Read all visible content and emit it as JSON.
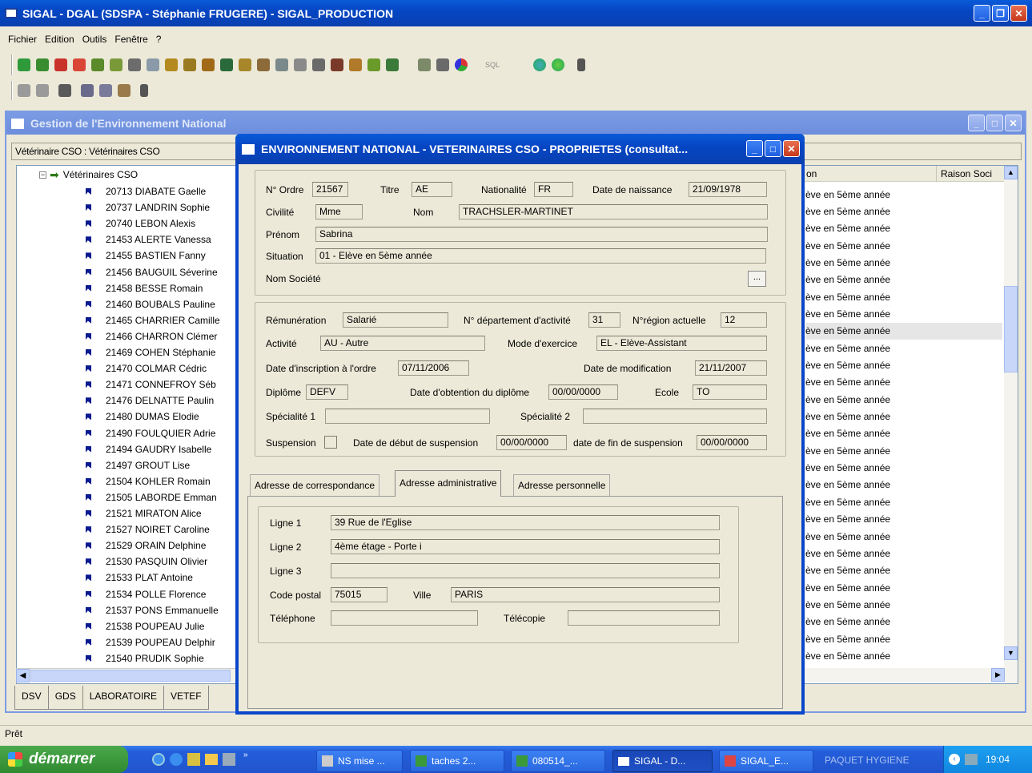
{
  "app": {
    "title": "SIGAL - DGAL (SDSPA - Stéphanie FRUGERE) - SIGAL_PRODUCTION",
    "menu": [
      "Fichier",
      "Edition",
      "Outils",
      "Fenêtre",
      "?"
    ],
    "status": "Prêt",
    "sql_label": "SQL"
  },
  "mdi": {
    "title": "Gestion de l'Environnement National",
    "breadcrumb": "Vétérinaire CSO : Vétérinaires CSO",
    "tree_root": "Vétérinaires CSO",
    "tree_items": [
      "20713 DIABATE Gaelle",
      "20737 LANDRIN Sophie",
      "20740 LEBON Alexis",
      "21453 ALERTE Vanessa",
      "21455 BASTIEN Fanny",
      "21456 BAUGUIL Séverine",
      "21458 BESSE Romain",
      "21460 BOUBALS Pauline",
      "21465 CHARRIER Camille",
      "21466 CHARRON Clémer",
      "21469 COHEN Stéphanie",
      "21470 COLMAR Cédric",
      "21471 CONNEFROY Séb",
      "21476 DELNATTE Paulin",
      "21480 DUMAS Elodie",
      "21490 FOULQUIER Adrie",
      "21494 GAUDRY Isabelle",
      "21497 GROUT Lise",
      "21504 KOHLER Romain",
      "21505 LABORDE Emman",
      "21521 MIRATON Alice",
      "21527 NOIRET Caroline",
      "21529 ORAIN Delphine",
      "21530 PASQUIN Olivier",
      "21533 PLAT Antoine",
      "21534 POLLE Florence",
      "21537 PONS Emmanuelle",
      "21538 POUPEAU Julie",
      "21539 POUPEAU Delphir",
      "21540 PRUDIK Sophie"
    ],
    "list_headers": [
      "on",
      "Raison Soci"
    ],
    "list_rows": [
      "ève en 5ème année",
      "ève en 5ème année",
      "ève en 5ème année",
      "ève en 5ème année",
      "ève en 5ème année",
      "ève en 5ème année",
      "ève en 5ème année",
      "ève en 5ème année",
      "ève en 5ème année",
      "ève en 5ème année",
      "ève en 5ème année",
      "ève en 5ème année",
      "ève en 5ème année",
      "ève en 5ème année",
      "ève en 5ème année",
      "ève en 5ème année",
      "ève en 5ème année",
      "ève en 5ème année",
      "ève en 5ème année",
      "ève en 5ème année",
      "ève en 5ème année",
      "ève en 5ème année",
      "ève en 5ème année",
      "ève en 5ème année",
      "ève en 5ème année",
      "ève en 5ème année",
      "ève en 5ème année",
      "ève en 5ème année"
    ],
    "bottom_tabs": [
      "DSV",
      "GDS",
      "LABORATOIRE",
      "VETEF"
    ]
  },
  "dialog": {
    "title": "ENVIRONNEMENT NATIONAL - VETERINAIRES CSO - PROPRIETES (consultat...",
    "labels": {
      "ordre": "N° Ordre",
      "titre": "Titre",
      "nationalite": "Nationalité",
      "naissance": "Date de naissance",
      "civilite": "Civilité",
      "nom": "Nom",
      "prenom": "Prénom",
      "situation": "Situation",
      "societe": "Nom Société",
      "remuneration": "Rémunération",
      "dept": "N° département d'activité",
      "region": "N°région actuelle",
      "activite": "Activité",
      "mode": "Mode d'exercice",
      "inscription": "Date d'inscription à l'ordre",
      "modification": "Date de modification",
      "diplome": "Diplôme",
      "obtention": "Date d'obtention du diplôme",
      "ecole": "Ecole",
      "spec1": "Spécialité 1",
      "spec2": "Spécialité 2",
      "suspension": "Suspension",
      "debut_susp": "Date de début de suspension",
      "fin_susp": "date de fin de suspension",
      "ligne1": "Ligne 1",
      "ligne2": "Ligne 2",
      "ligne3": "Ligne 3",
      "cp": "Code postal",
      "ville": "Ville",
      "tel": "Téléphone",
      "fax": "Télécopie"
    },
    "values": {
      "ordre": "21567",
      "titre": "AE",
      "nationalite": "FR",
      "naissance": "21/09/1978",
      "civilite": "Mme",
      "nom": "TRACHSLER-MARTINET",
      "prenom": "Sabrina",
      "situation": "01 - Elève en 5ème année",
      "societe": "",
      "remuneration": "Salarié",
      "dept": "31",
      "region": "12",
      "activite": "AU - Autre",
      "mode": "EL - Elève-Assistant",
      "inscription": "07/11/2006",
      "modification": "21/11/2007",
      "diplome": "DEFV",
      "obtention": "00/00/0000",
      "ecole": "TO",
      "spec1": "",
      "spec2": "",
      "debut_susp": "00/00/0000",
      "fin_susp": "00/00/0000",
      "ligne1": "39 Rue de l'Eglise",
      "ligne2": "4ème étage - Porte i",
      "ligne3": "",
      "cp": "75015",
      "ville": "PARIS",
      "tel": "",
      "fax": ""
    },
    "browse_label": "...",
    "tabs": [
      "Adresse de correspondance",
      "Adresse administrative",
      "Adresse personnelle"
    ]
  },
  "taskbar": {
    "start": "démarrer",
    "tasks": [
      "NS mise ...",
      "taches 2...",
      "080514_...",
      "SIGAL - D...",
      "SIGAL_E...",
      "PAQUET HYGIENE"
    ],
    "clock": "19:04"
  }
}
